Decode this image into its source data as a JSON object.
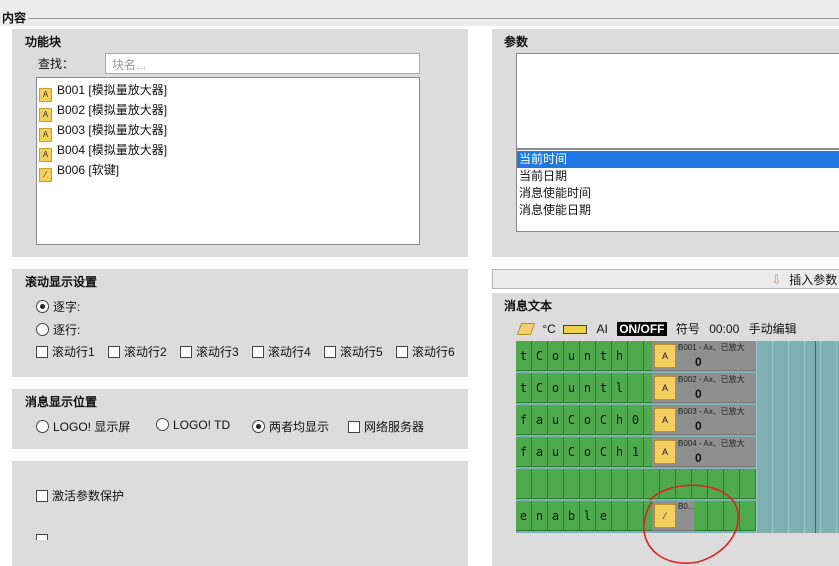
{
  "header": {
    "title": "内容"
  },
  "func_blocks": {
    "title": "功能块",
    "search_label": "查找：",
    "search_placeholder": "块名...",
    "items": [
      {
        "label": "B001 [模拟量放大器]",
        "icon": "analog-amplifier-icon"
      },
      {
        "label": "B002 [模拟量放大器]",
        "icon": "analog-amplifier-icon"
      },
      {
        "label": "B003 [模拟量放大器]",
        "icon": "analog-amplifier-icon"
      },
      {
        "label": "B004 [模拟量放大器]",
        "icon": "analog-amplifier-icon"
      },
      {
        "label": "B006 [软键]",
        "icon": "soft-key-icon"
      }
    ]
  },
  "params": {
    "title": "参数",
    "options": [
      "当前时间",
      "当前日期",
      "消息使能时间",
      "消息使能日期"
    ],
    "selected": "当前时间",
    "insert_button": "插入参数"
  },
  "scroll": {
    "title": "滚动显示设置",
    "by_char": "逐字:",
    "by_line": "逐行:",
    "selected": "逐字:",
    "lines": [
      "滚动行1",
      "滚动行2",
      "滚动行3",
      "滚动行4",
      "滚动行5",
      "滚动行6"
    ]
  },
  "position": {
    "title": "消息显示位置",
    "options": [
      "LOGO! 显示屏",
      "LOGO! TD",
      "两者均显示",
      "网络服务器"
    ],
    "selected": "两者均显示"
  },
  "protect": {
    "label": "激活参数保护"
  },
  "message": {
    "title": "消息文本",
    "toolbar": {
      "celsius": "°C",
      "ai": "AI",
      "onoff": "ON/OFF",
      "symbol": "符号",
      "time": "00:00",
      "manual_edit": "手动编辑"
    },
    "rows": [
      {
        "text": "tCounth",
        "block_title": "B001 - Ax、已放大",
        "value": "0"
      },
      {
        "text": "tCountl",
        "block_title": "B002 - Ax、已放大",
        "value": "0"
      },
      {
        "text": "fauCoCh0",
        "block_title": "B003 - Ax、已放大",
        "value": "0"
      },
      {
        "text": "fauCoCh1",
        "block_title": "B004 - Ax、已放大",
        "value": "0"
      },
      {
        "text": "enable",
        "block_title": "B0...",
        "value": ""
      }
    ]
  },
  "colors": {
    "grid_green": "#4faa4e",
    "grid_teal": "#7fb0b2",
    "selection_blue": "#1e78e0",
    "annotation_red": "#e02020"
  }
}
